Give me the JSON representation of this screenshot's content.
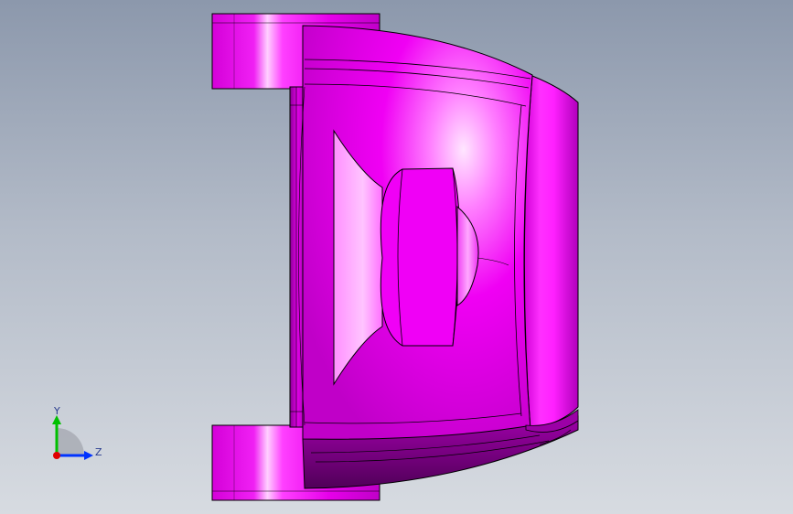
{
  "viewport": {
    "part_color": "#ff00ff",
    "part_shadow_color": "#6b0070",
    "edge_color": "#000000"
  },
  "triad": {
    "y_label": "Y",
    "z_label": "Z",
    "y_color": "#00c000",
    "z_color": "#0033ff",
    "x_color": "#e00000"
  }
}
